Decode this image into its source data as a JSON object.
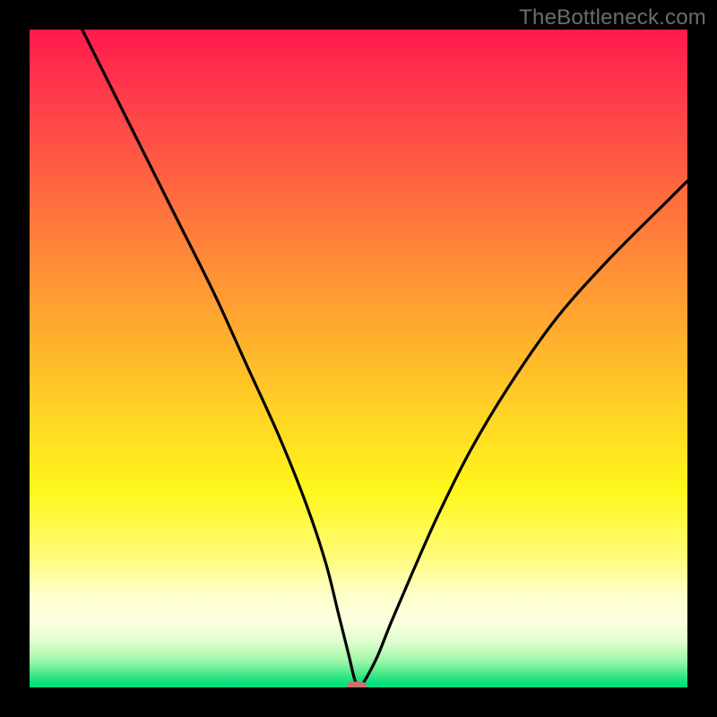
{
  "watermark": "TheBottleneck.com",
  "chart_data": {
    "type": "line",
    "title": "",
    "xlabel": "",
    "ylabel": "",
    "xlim": [
      0,
      100
    ],
    "ylim": [
      0,
      100
    ],
    "grid": false,
    "legend": false,
    "series": [
      {
        "name": "curve",
        "x": [
          8,
          15,
          22,
          28,
          33,
          38,
          42,
          45,
          47,
          48.5,
          49.2,
          49.6,
          49.9,
          50.5,
          51.5,
          53,
          55,
          58,
          62,
          67,
          73,
          80,
          88,
          97,
          100
        ],
        "y": [
          100,
          86,
          72,
          60,
          49,
          38,
          28,
          19,
          11,
          5,
          2,
          0.7,
          0,
          0.4,
          2,
          5,
          10,
          17,
          26,
          36,
          46,
          56,
          65,
          74,
          77
        ]
      }
    ],
    "marker": {
      "x": 49.7,
      "y": 0
    },
    "background_gradient": {
      "top": "#ff1a4d",
      "mid": "#fff71b",
      "bottom": "#00dd7c"
    }
  }
}
